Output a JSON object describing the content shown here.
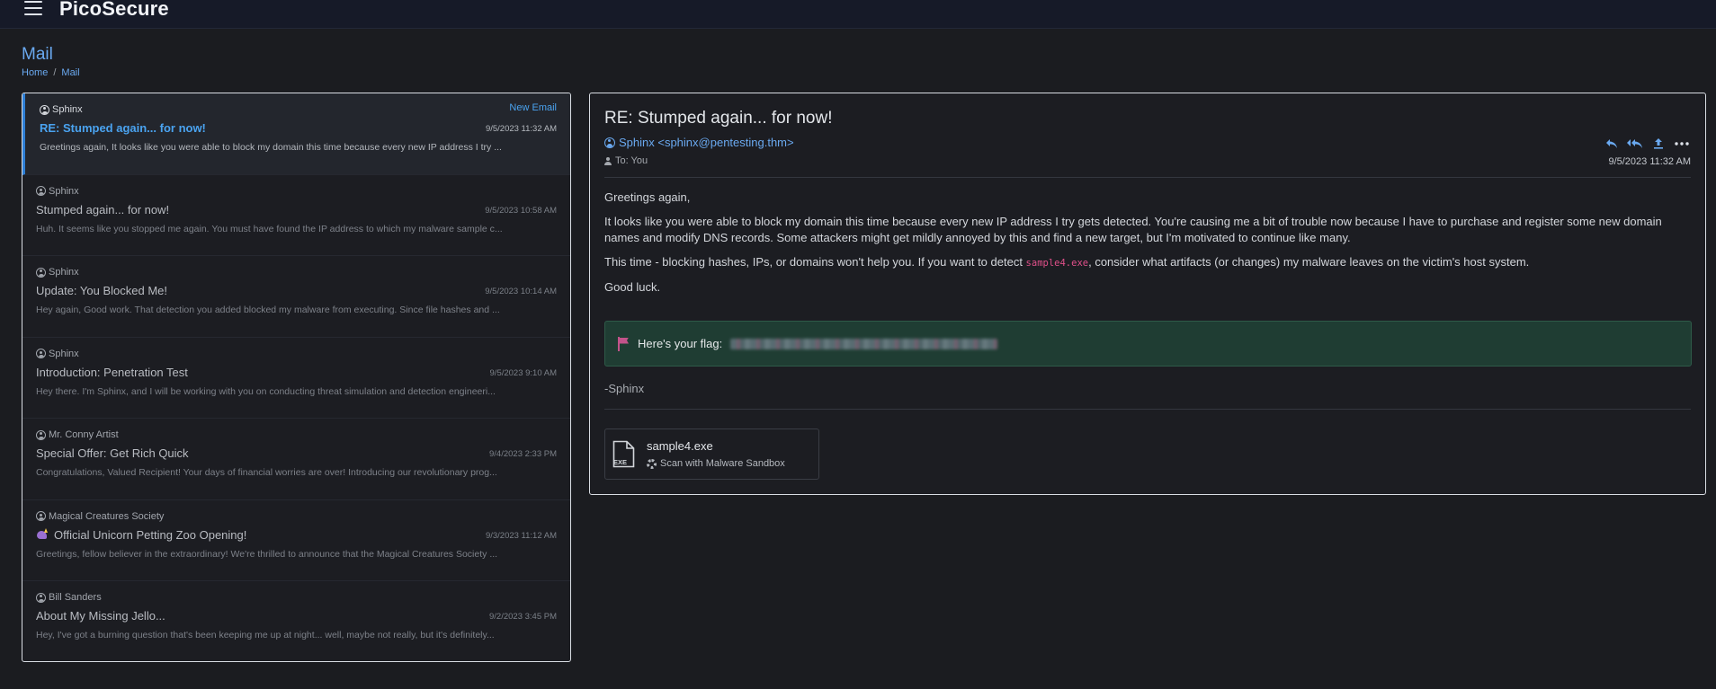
{
  "app": {
    "brand": "PicoSecure"
  },
  "page": {
    "title": "Mail",
    "breadcrumb": {
      "home": "Home",
      "separator": "/",
      "current": "Mail"
    }
  },
  "mail_list": [
    {
      "sender": "Sphinx",
      "badge": "New Email",
      "subject": "RE: Stumped again... for now!",
      "time": "9/5/2023 11:32 AM",
      "preview": "Greetings again, It looks like you were able to block my domain this time because every new IP address I try ...",
      "active": true
    },
    {
      "sender": "Sphinx",
      "subject": "Stumped again... for now!",
      "time": "9/5/2023 10:58 AM",
      "preview": "Huh. It seems like you stopped me again. You must have found the IP address to which my malware sample c..."
    },
    {
      "sender": "Sphinx",
      "subject": "Update: You Blocked Me!",
      "time": "9/5/2023 10:14 AM",
      "preview": "Hey again, Good work. That detection you added blocked my malware from executing. Since file hashes and ..."
    },
    {
      "sender": "Sphinx",
      "subject": "Introduction: Penetration Test",
      "time": "9/5/2023 9:10 AM",
      "preview": "Hey there. I'm Sphinx, and I will be working with you on conducting threat simulation and detection engineeri..."
    },
    {
      "sender": "Mr. Conny Artist",
      "subject": "Special Offer: Get Rich Quick",
      "time": "9/4/2023 2:33 PM",
      "preview": "Congratulations, Valued Recipient! Your days of financial worries are over! Introducing our revolutionary prog..."
    },
    {
      "sender": "Magical Creatures Society",
      "subject": "Official Unicorn Petting Zoo Opening!",
      "subject_icon": "unicorn-icon",
      "time": "9/3/2023 11:12 AM",
      "preview": "Greetings, fellow believer in the extraordinary! We're thrilled to announce that the Magical Creatures Society ..."
    },
    {
      "sender": "Bill Sanders",
      "subject": "About My Missing Jello...",
      "time": "9/2/2023 3:45 PM",
      "preview": "Hey, I've got a burning question that's been keeping me up at night... well, maybe not really, but it's definitely..."
    }
  ],
  "reader": {
    "subject": "RE: Stumped again... for now!",
    "from": "Sphinx <sphinx@pentesting.thm>",
    "to": "To: You",
    "time": "9/5/2023 11:32 AM",
    "actions": [
      "reply-icon",
      "reply-all-icon",
      "forward-icon",
      "more-icon"
    ],
    "body": {
      "greeting": "Greetings again,",
      "p1": "It looks like you were able to block my domain this time because every new IP address I try gets detected. You're causing me a bit of trouble now because I have to purchase and register some new domain names and modify DNS records. Some attackers might get mildly annoyed by this and find a new target, but I'm motivated to continue like many.",
      "p2_before": "This time - blocking hashes, IPs, or domains won't help you. If you want to detect ",
      "p2_code": "sample4.exe",
      "p2_after": ", consider what artifacts (or changes) my malware leaves on the victim's host system.",
      "closing": "Good luck."
    },
    "flag_label": "Here's your flag:",
    "signature": "-Sphinx",
    "attachment": {
      "name": "sample4.exe",
      "icon_label": "EXE",
      "scan_label": "Scan with Malware Sandbox"
    }
  },
  "colors": {
    "accent": "#4aa3f0",
    "topbar": "#161a28",
    "background": "#1b1c20",
    "flag_bg": "#1f3d33",
    "code": "#e0508a"
  }
}
